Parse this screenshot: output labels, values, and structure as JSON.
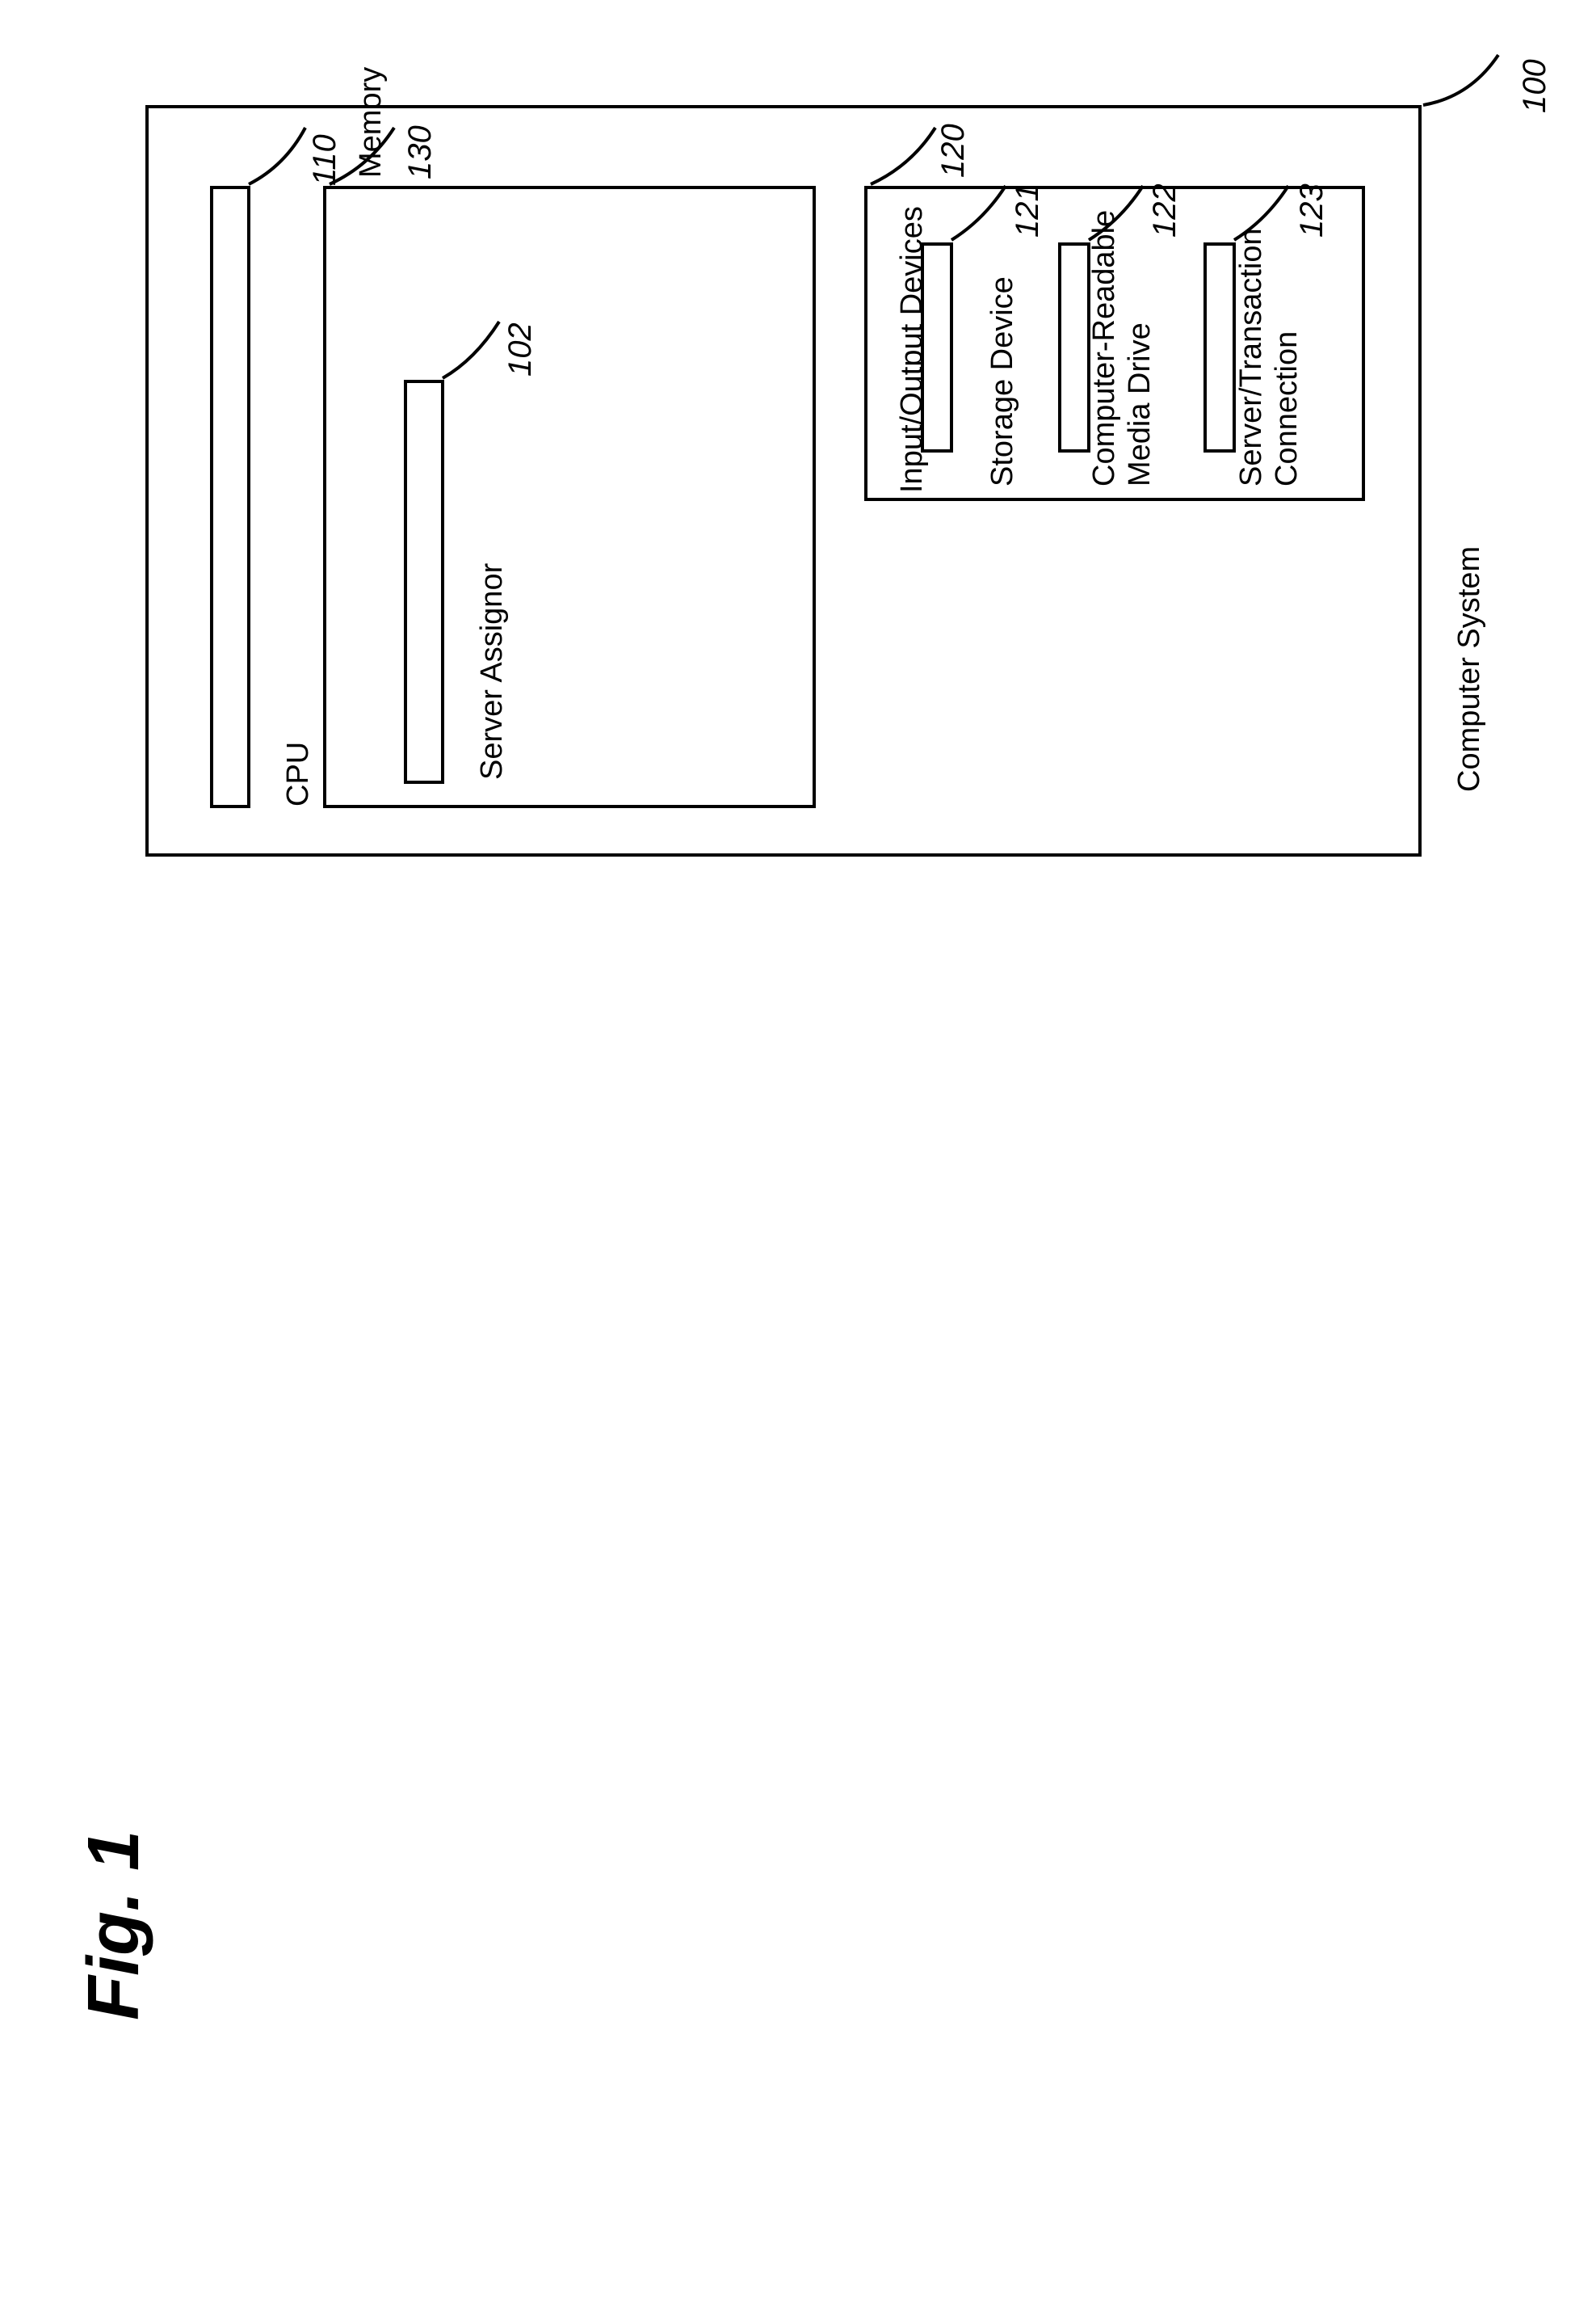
{
  "figure": {
    "caption": "Fig. 1",
    "system_label": "Computer System",
    "system_ref": "100",
    "cpu_label": "CPU",
    "cpu_ref": "110",
    "memory_label": "Memory",
    "memory_ref": "130",
    "server_assignor_label": "Server Assignor",
    "server_assignor_ref": "102",
    "io_label": "Input/Output Devices",
    "io_ref": "120",
    "storage_label": "Storage Device",
    "storage_ref": "121",
    "media_drive_label1": "Computer-Readable",
    "media_drive_label2": "Media Drive",
    "media_drive_ref": "122",
    "server_conn_label1": "Server/Transaction",
    "server_conn_label2": "Connection",
    "server_conn_ref": "123"
  }
}
